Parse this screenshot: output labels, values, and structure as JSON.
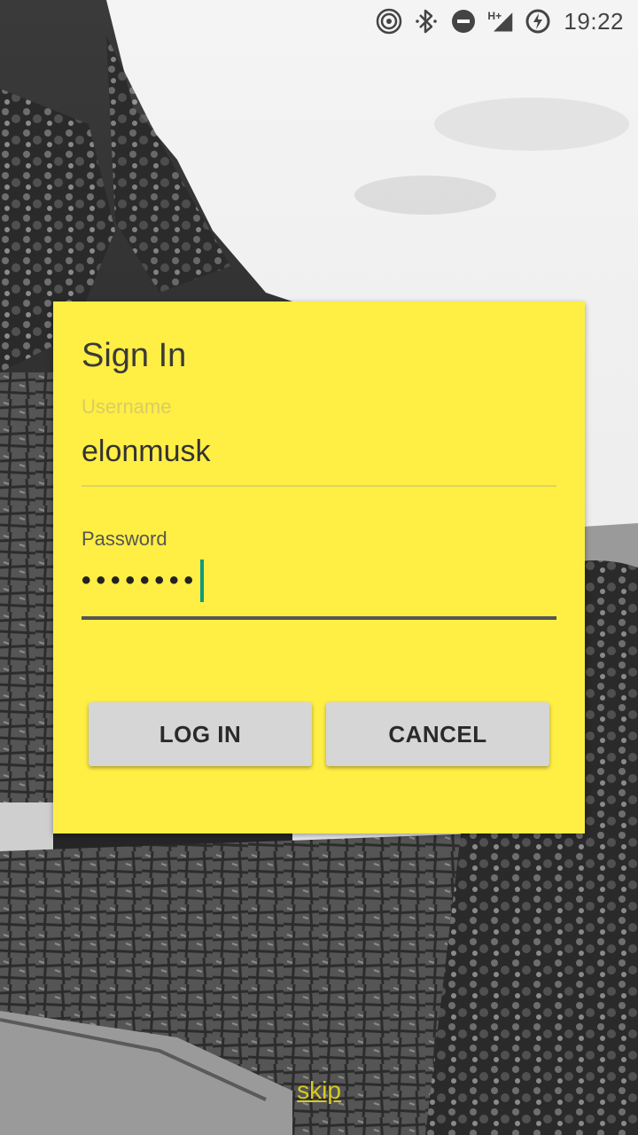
{
  "status_bar": {
    "time": "19:22",
    "icons": [
      "hotspot-icon",
      "bluetooth-icon",
      "do-not-disturb-icon",
      "signal-icon",
      "battery-charging-icon"
    ],
    "network_type": "H+"
  },
  "dialog": {
    "title": "Sign In",
    "username": {
      "label": "Username",
      "value": "elonmusk"
    },
    "password": {
      "label": "Password",
      "masked_value": "••••••••"
    },
    "buttons": {
      "login": "LOG IN",
      "cancel": "CANCEL"
    },
    "background_color": "#ffee44",
    "accent_color": "#129a7a"
  },
  "skip_link": "skip"
}
